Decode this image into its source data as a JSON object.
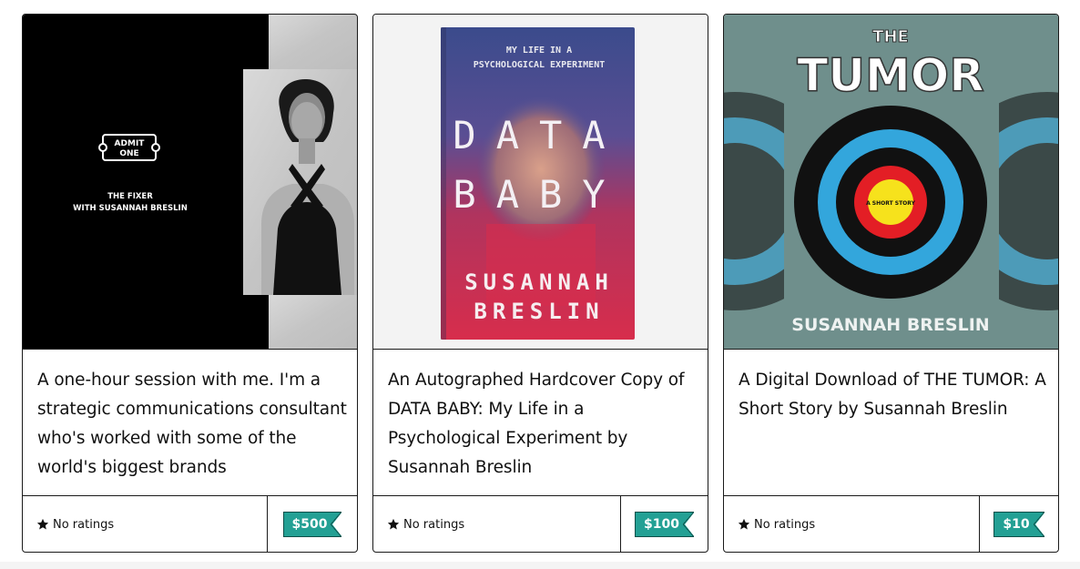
{
  "cards": [
    {
      "cover": {
        "ticket_line1": "ADMIT",
        "ticket_line2": "ONE",
        "line1": "THE FIXER",
        "line2": "WITH SUSANNAH BRESLIN"
      },
      "title": "A one-hour session with me. I'm a strategic communications consultant who's worked with some of the world's biggest brands",
      "rating_text": "No ratings",
      "price": "$500"
    },
    {
      "cover": {
        "subtitle_line1": "MY LIFE IN A",
        "subtitle_line2": "PSYCHOLOGICAL EXPERIMENT",
        "title_line1": "DATA",
        "title_line2": "BABY",
        "author_line1": "SUSANNAH",
        "author_line2": "BRESLIN"
      },
      "title": "An Autographed Hardcover Copy of DATA BABY: My Life in a Psychological Experiment by Susannah Breslin",
      "rating_text": "No ratings",
      "price": "$100"
    },
    {
      "cover": {
        "the": "THE",
        "tumor": "TUMOR",
        "bullseye_text": "A SHORT STORY",
        "author": "SUSANNAH BRESLIN"
      },
      "title": "A Digital Download of THE TUMOR: A Short Story by Susannah Breslin",
      "rating_text": "No ratings",
      "price": "$10"
    }
  ],
  "colors": {
    "price_tag": "#23a094",
    "card_border": "#1a1a1a",
    "target_black": "#111111",
    "target_blue": "#33a6dc",
    "target_red": "#e31e25",
    "target_yellow": "#f6e21c",
    "tumor_bg": "#6f8f8c"
  },
  "icons": {
    "rating": "star-icon"
  }
}
